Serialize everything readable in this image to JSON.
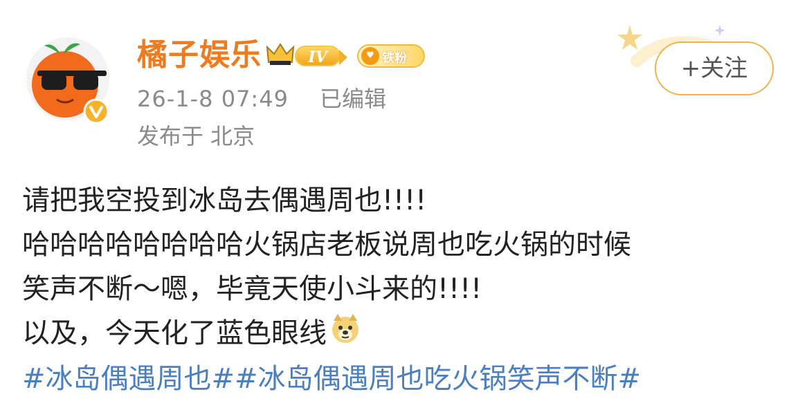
{
  "user": {
    "name": "橘子娱乐",
    "level_badge": "IV",
    "fan_badge": "铁粉",
    "avatar_icon": "orange-sunglasses-avatar",
    "verified_icon": "verified-v-icon"
  },
  "post_meta": {
    "timestamp": "26-1-8 07:49",
    "edited_label": "已编辑",
    "location_label": "发布于 北京"
  },
  "actions": {
    "follow_label": "+关注"
  },
  "post": {
    "lines": [
      "请把我空投到冰岛去偶遇周也!!!!",
      "哈哈哈哈哈哈哈哈火锅店老板说周也吃火锅的时候",
      "笑声不断～嗯，毕竟天使小斗来的!!!!",
      "以及，今天化了蓝色眼线"
    ],
    "emoji_icon": "doge-emoji-icon",
    "hashtags": [
      "#冰岛偶遇周也#",
      "#冰岛偶遇周也吃火锅笑声不断#"
    ]
  },
  "colors": {
    "username": "#f07b1f",
    "meta_text": "#8a8a8a",
    "hashtag": "#4a7fc1",
    "follow_border": "#f0b24a"
  }
}
